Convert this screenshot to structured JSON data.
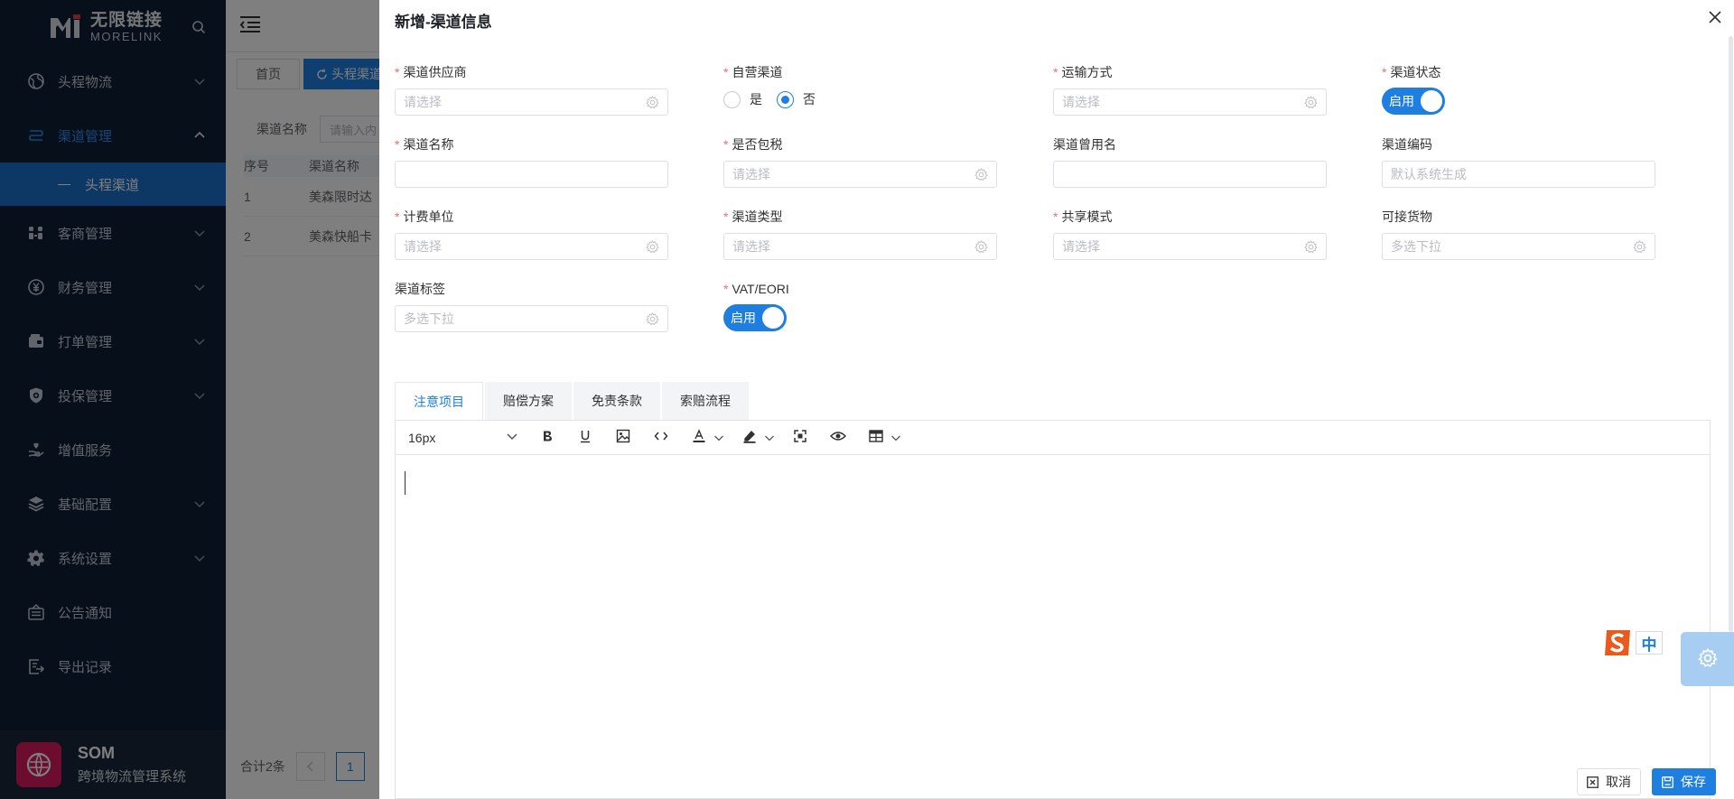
{
  "brand": {
    "cn": "无限链接",
    "en": "MORELINK"
  },
  "sidebar": {
    "items": [
      {
        "label": "头程物流",
        "icon": "globe-icon",
        "chevron": true
      },
      {
        "label": "渠道管理",
        "icon": "route-icon",
        "chevron": true,
        "active": true
      },
      {
        "label": "客商管理",
        "icon": "users-icon",
        "chevron": true
      },
      {
        "label": "财务管理",
        "icon": "yen-icon",
        "chevron": true
      },
      {
        "label": "打单管理",
        "icon": "wallet-icon",
        "chevron": true
      },
      {
        "label": "投保管理",
        "icon": "shield-icon",
        "chevron": true
      },
      {
        "label": "增值服务",
        "icon": "heart-hand-icon",
        "chevron": false
      },
      {
        "label": "基础配置",
        "icon": "layers-icon",
        "chevron": true
      },
      {
        "label": "系统设置",
        "icon": "gear-icon",
        "chevron": true
      },
      {
        "label": "公告通知",
        "icon": "notice-icon",
        "chevron": false
      },
      {
        "label": "导出记录",
        "icon": "export-icon",
        "chevron": false
      }
    ],
    "submenu": {
      "label": "头程渠道"
    },
    "footer": {
      "title": "SOM",
      "subtitle": "跨境物流管理系统"
    }
  },
  "background": {
    "tabs": {
      "home": "首页",
      "active": "头程渠道"
    },
    "filter": {
      "label": "渠道名称",
      "placeholder": "请输入内"
    },
    "table": {
      "headers": [
        "序号",
        "渠道名称"
      ],
      "rows": [
        [
          "1",
          "美森限时达"
        ],
        [
          "2",
          "美森快船卡"
        ]
      ]
    },
    "pagination": {
      "total": "合计2条",
      "page": "1"
    }
  },
  "drawer": {
    "title": "新增-渠道信息",
    "fields": {
      "supplier": {
        "label": "渠道供应商",
        "required": true,
        "placeholder": "请选择"
      },
      "self_operated": {
        "label": "自营渠道",
        "required": true,
        "options": [
          "是",
          "否"
        ],
        "selected": "否"
      },
      "transport": {
        "label": "运输方式",
        "required": true,
        "placeholder": "请选择"
      },
      "status": {
        "label": "渠道状态",
        "required": true,
        "switch_text": "启用"
      },
      "name": {
        "label": "渠道名称",
        "required": true,
        "value": ""
      },
      "tax_included": {
        "label": "是否包税",
        "required": true,
        "placeholder": "请选择"
      },
      "alias": {
        "label": "渠道曾用名",
        "required": false,
        "value": ""
      },
      "code": {
        "label": "渠道编码",
        "required": false,
        "placeholder": "默认系统生成"
      },
      "billing_unit": {
        "label": "计费单位",
        "required": true,
        "placeholder": "请选择"
      },
      "channel_type": {
        "label": "渠道类型",
        "required": true,
        "placeholder": "请选择"
      },
      "share_mode": {
        "label": "共享模式",
        "required": true,
        "placeholder": "请选择"
      },
      "goods": {
        "label": "可接货物",
        "required": false,
        "placeholder": "多选下拉"
      },
      "tags": {
        "label": "渠道标签",
        "required": false,
        "placeholder": "多选下拉"
      },
      "vat": {
        "label": "VAT/EORI",
        "required": true,
        "switch_text": "启用"
      }
    },
    "editor_tabs": [
      "注意项目",
      "赔偿方案",
      "免责条款",
      "索赔流程"
    ],
    "editor": {
      "font_size": "16px"
    },
    "ime": {
      "label": "中"
    },
    "buttons": {
      "cancel": "取消",
      "save": "保存"
    }
  }
}
